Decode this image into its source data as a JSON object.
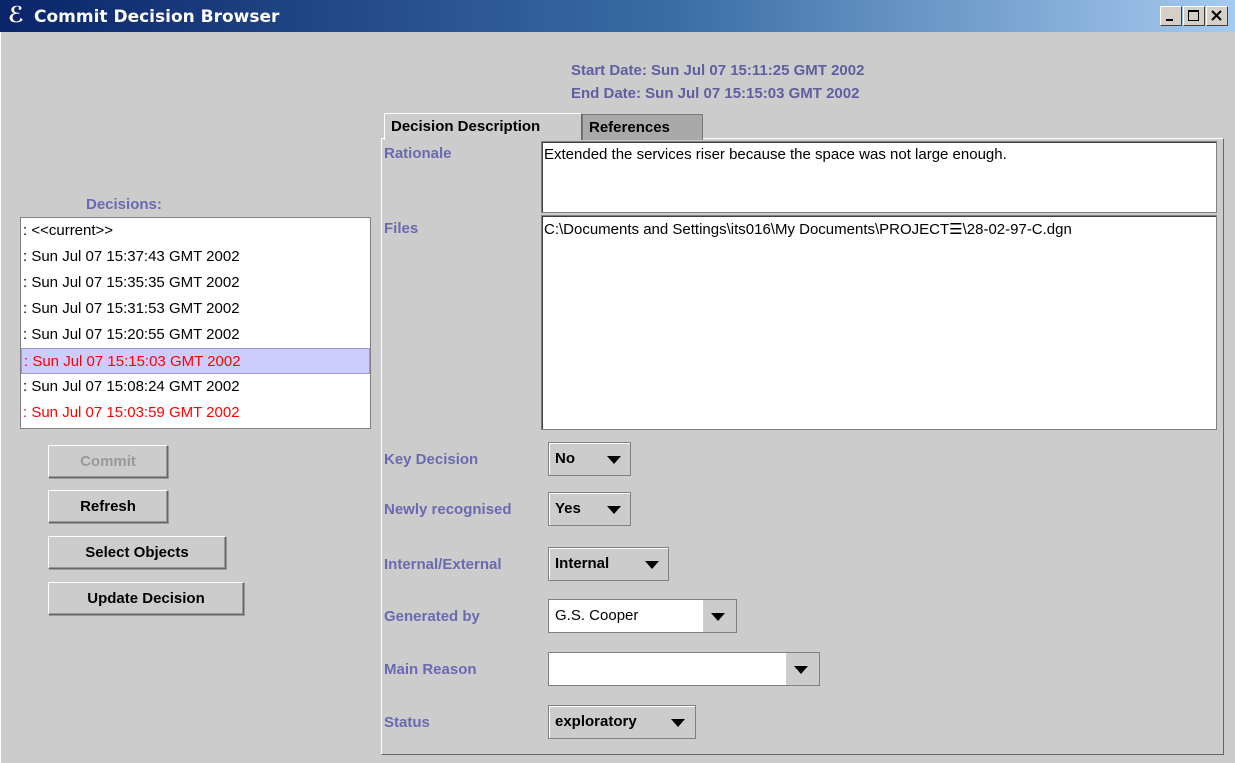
{
  "window": {
    "title": "Commit Decision Browser",
    "app_icon": "coloured-e-icon"
  },
  "header": {
    "start_date": "Start Date: Sun Jul 07 15:11:25 GMT 2002",
    "end_date": "End Date: Sun Jul 07 15:15:03 GMT 2002"
  },
  "decisions": {
    "label": "Decisions:",
    "items": [
      {
        "text": ": <<current>>",
        "color": "#000000",
        "selected": false
      },
      {
        "text": ": Sun Jul 07 15:37:43 GMT 2002",
        "color": "#000000",
        "selected": false
      },
      {
        "text": ": Sun Jul 07 15:35:35 GMT 2002",
        "color": "#000000",
        "selected": false
      },
      {
        "text": ": Sun Jul 07 15:31:53 GMT 2002",
        "color": "#000000",
        "selected": false
      },
      {
        "text": ": Sun Jul 07 15:20:55 GMT 2002",
        "color": "#000000",
        "selected": false
      },
      {
        "text": ": Sun Jul 07 15:15:03 GMT 2002",
        "color": "#ff0000",
        "selected": true
      },
      {
        "text": ": Sun Jul 07 15:08:24 GMT 2002",
        "color": "#000000",
        "selected": false
      },
      {
        "text": ": Sun Jul 07 15:03:59 GMT 2002",
        "color": "#ff0000",
        "selected": false
      }
    ]
  },
  "buttons": {
    "commit": "Commit",
    "refresh": "Refresh",
    "select_objects": "Select Objects",
    "update_decision": "Update Decision"
  },
  "tabs": {
    "decision_description": "Decision Description",
    "references": "References"
  },
  "form": {
    "rationale_label": "Rationale",
    "rationale_value": "Extended the services riser because the space was not large enough.",
    "files_label": "Files",
    "files_value": "C:\\Documents and Settings\\its016\\My Documents\\PROJECT☰\\28-02-97-C.dgn",
    "key_decision_label": "Key Decision",
    "key_decision_value": "No",
    "newly_recognised_label": "Newly recognised",
    "newly_recognised_value": "Yes",
    "internal_external_label": "Internal/External",
    "internal_external_value": "Internal",
    "generated_by_label": "Generated by",
    "generated_by_value": "G.S. Cooper",
    "main_reason_label": "Main Reason",
    "main_reason_value": "",
    "status_label": "Status",
    "status_value": "exploratory"
  },
  "colors": {
    "label_blue": "#6a6ab0",
    "selection": "#ccccff",
    "highlight_red": "#ff0000"
  }
}
